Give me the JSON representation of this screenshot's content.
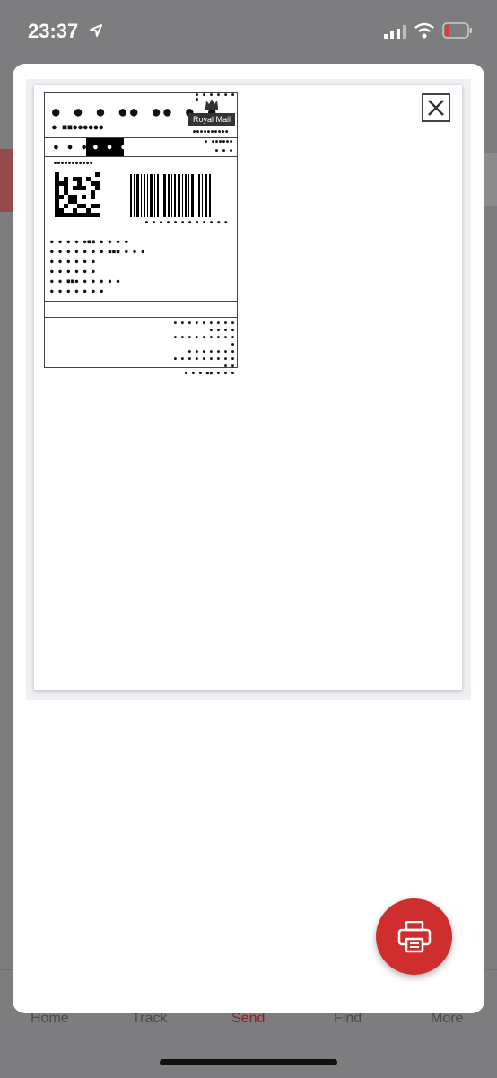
{
  "status_bar": {
    "time": "23:37",
    "icons": [
      "location-arrow-icon",
      "cellular-signal-icon",
      "wifi-icon",
      "battery-low-icon"
    ]
  },
  "label": {
    "brand_text": "Royal Mail"
  },
  "tabs": [
    {
      "label": "Home"
    },
    {
      "label": "Track"
    },
    {
      "label": "Send",
      "active": true
    },
    {
      "label": "Find"
    },
    {
      "label": "More"
    }
  ],
  "colors": {
    "accent": "#cf2e2e",
    "active_tab": "#8a2222"
  }
}
